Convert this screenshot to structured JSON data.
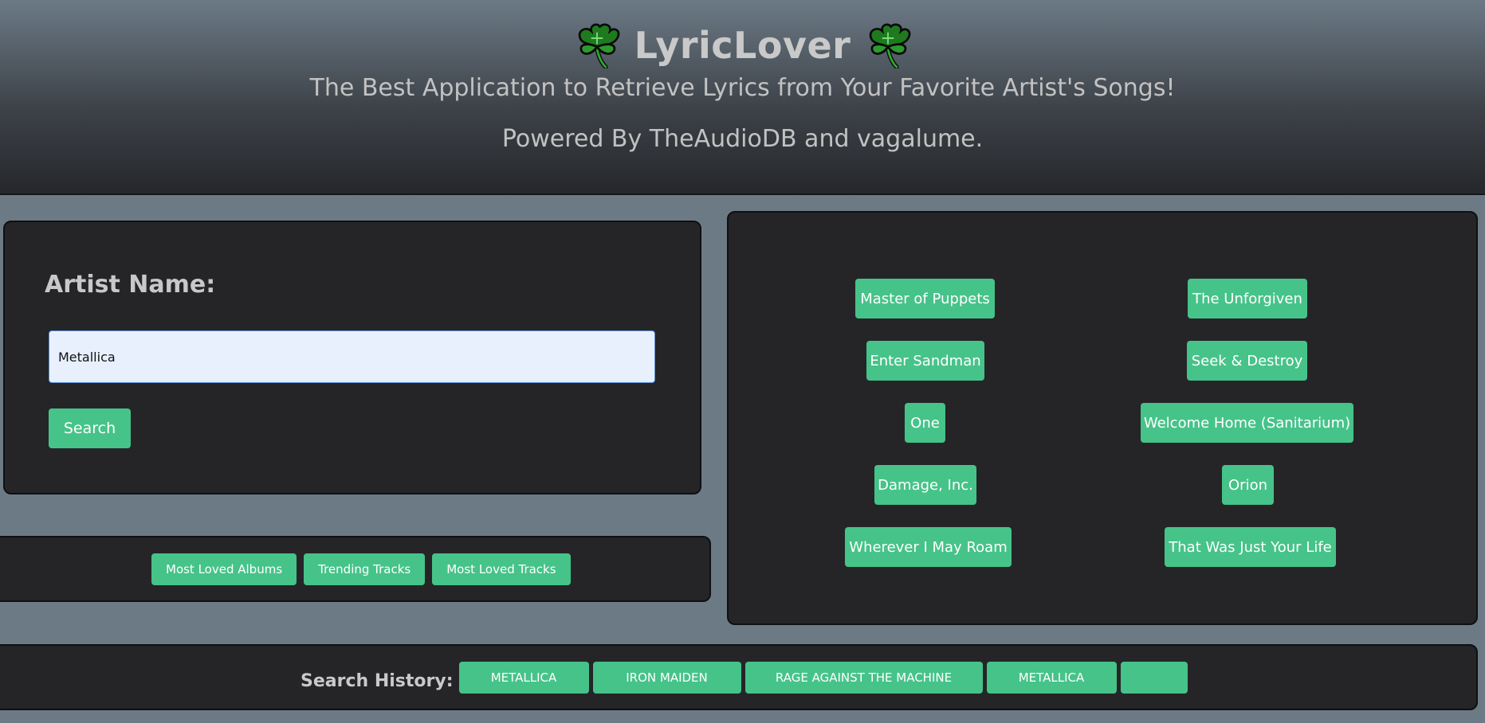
{
  "header": {
    "icon_left": "shamrock-icon",
    "icon_right": "shamrock-icon",
    "title": "LyricLover",
    "tagline": "The Best Application to Retrieve Lyrics from Your Favorite Artist's Songs!",
    "powered_by": "Powered By TheAudioDB and vagalume."
  },
  "search": {
    "label": "Artist Name:",
    "value": "Metallica",
    "button_label": "Search"
  },
  "charts": {
    "buttons": [
      "Most Loved Albums",
      "Trending Tracks",
      "Most Loved Tracks"
    ]
  },
  "tracks": {
    "items": [
      "Master of Puppets",
      "The Unforgiven",
      "Enter Sandman",
      "Seek & Destroy",
      "One",
      "Welcome Home (Sanitarium)",
      "Damage, Inc.",
      "Orion",
      "Wherever I May Roam",
      "That Was Just Your Life"
    ]
  },
  "history": {
    "label": "Search History:",
    "items": [
      "METALLICA",
      "IRON MAIDEN",
      "RAGE AGAINST THE MACHINE",
      "METALLICA",
      ""
    ]
  },
  "colors": {
    "accent": "#46c389",
    "page_background": "#6c7a86",
    "panel_background": "#252528"
  }
}
